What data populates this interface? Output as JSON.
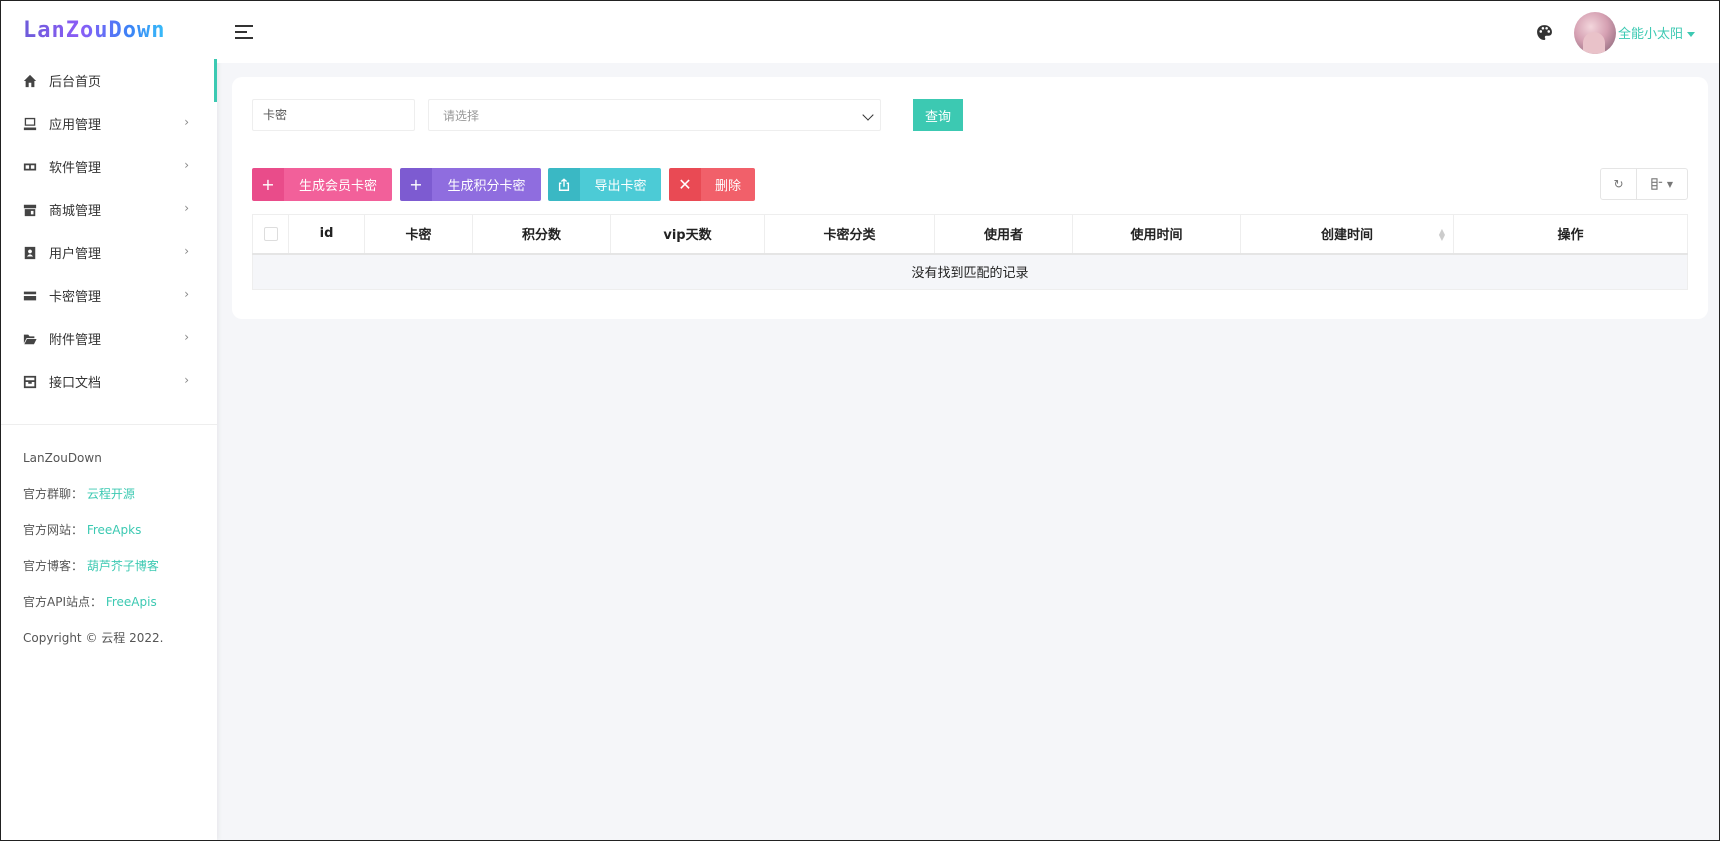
{
  "brand": {
    "logo_text": "LanZouDown"
  },
  "sidebar": {
    "items": [
      {
        "label": "后台首页",
        "icon": "home-icon",
        "active": true,
        "has_children": false
      },
      {
        "label": "应用管理",
        "icon": "desktop-icon",
        "active": false,
        "has_children": true
      },
      {
        "label": "软件管理",
        "icon": "archive-icon",
        "active": false,
        "has_children": true
      },
      {
        "label": "商城管理",
        "icon": "store-icon",
        "active": false,
        "has_children": true
      },
      {
        "label": "用户管理",
        "icon": "user-badge-icon",
        "active": false,
        "has_children": true
      },
      {
        "label": "卡密管理",
        "icon": "credit-card-icon",
        "active": false,
        "has_children": true
      },
      {
        "label": "附件管理",
        "icon": "folder-open-icon",
        "active": false,
        "has_children": true
      },
      {
        "label": "接口文档",
        "icon": "inbox-icon",
        "active": false,
        "has_children": true
      }
    ],
    "footer": {
      "app_name": "LanZouDown",
      "group_label": "官方群聊：",
      "group_link": "云程开源",
      "site_label": "官方网站：",
      "site_link": "FreeApks",
      "blog_label": "官方博客：",
      "blog_link": "葫芦芥子博客",
      "api_label": "官方API站点：",
      "api_link": "FreeApis",
      "copyright": "Copyright © 云程 2022."
    }
  },
  "header": {
    "username": "全能小太阳",
    "icons": [
      "hamburger-menu-icon",
      "palette-icon",
      "avatar"
    ]
  },
  "filters": {
    "card_placeholder": "卡密",
    "select_value": "请选择",
    "query_label": "查询"
  },
  "actions": {
    "generate_member": "生成会员卡密",
    "generate_points": "生成积分卡密",
    "export": "导出卡密",
    "delete": "删除"
  },
  "table": {
    "columns": [
      "id",
      "卡密",
      "积分数",
      "vip天数",
      "卡密分类",
      "使用者",
      "使用时间",
      "创建时间",
      "操作"
    ],
    "empty_text": "没有找到匹配的记录"
  },
  "colors": {
    "accent": "#3cc9b2",
    "member_btn": "#f2609a",
    "points_btn": "#8f6ddf",
    "export_btn": "#4ccbd6",
    "delete_btn": "#f1606a"
  }
}
